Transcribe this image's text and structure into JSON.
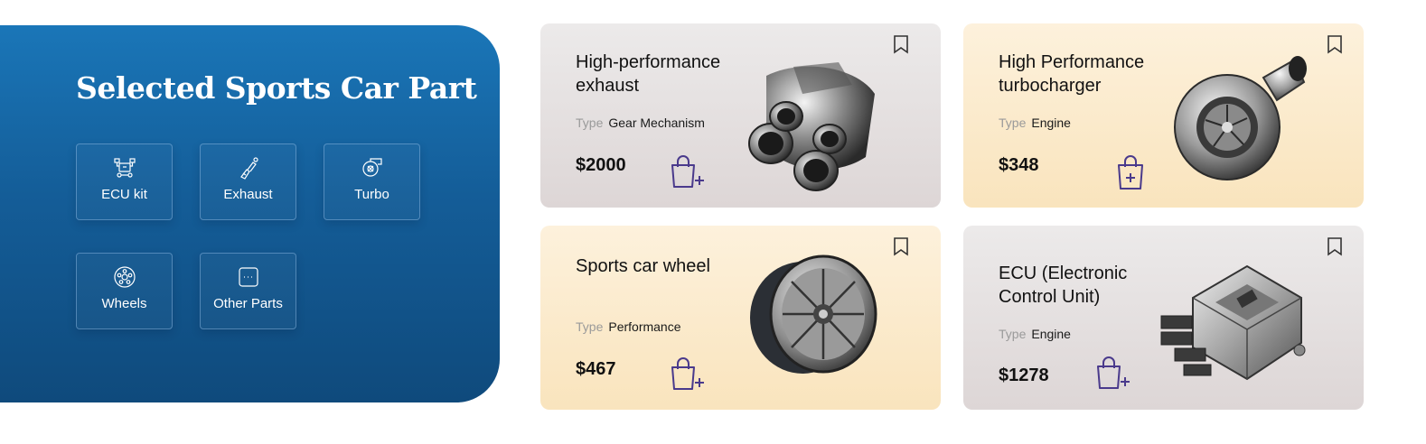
{
  "panel": {
    "title": "Selected Sports Car Part",
    "categories": [
      {
        "label": "ECU kit",
        "icon": "ecu-kit-icon"
      },
      {
        "label": "Exhaust",
        "icon": "exhaust-icon"
      },
      {
        "label": "Turbo",
        "icon": "turbo-icon"
      },
      {
        "label": "Wheels",
        "icon": "wheel-icon"
      },
      {
        "label": "Other Parts",
        "icon": "other-parts-icon"
      }
    ]
  },
  "products": [
    {
      "name": "High-performance exhaust",
      "type_label": "Type",
      "type": "Gear Mechanism",
      "price": "$2000",
      "image": "exhaust-image"
    },
    {
      "name": "High Performance turbocharger",
      "type_label": "Type",
      "type": "Engine",
      "price": "$348",
      "image": "turbocharger-image"
    },
    {
      "name": "Sports car wheel",
      "type_label": "Type",
      "type": "Performance",
      "price": "$467",
      "image": "wheel-image"
    },
    {
      "name": "ECU (Electronic Control Unit)",
      "type_label": "Type",
      "type": "Engine",
      "price": "$1278",
      "image": "ecu-image"
    }
  ],
  "colors": {
    "panel_top": "#1a76b8",
    "panel_bottom": "#0f4a7c",
    "accent_bag": "#4a3a8c",
    "card_gray": "#e6e2e2",
    "card_cream": "#fbe9c8"
  }
}
